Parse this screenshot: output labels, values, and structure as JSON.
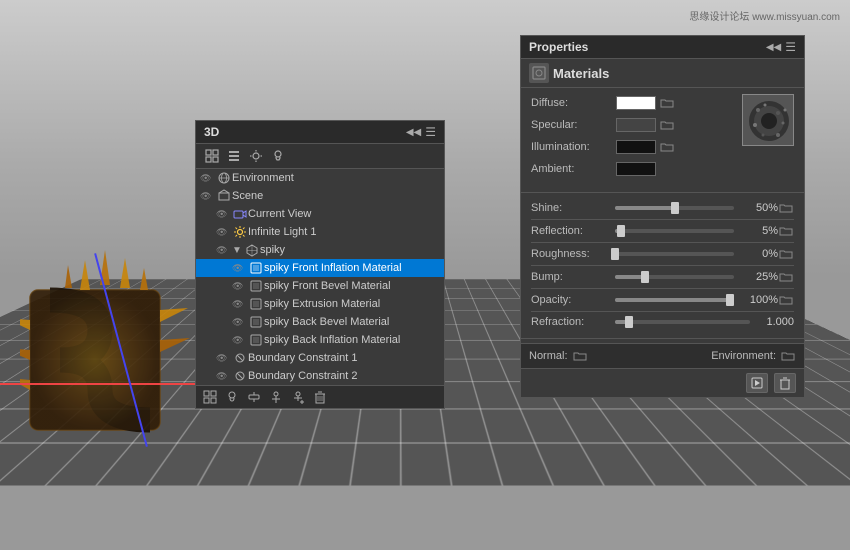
{
  "watermark": "思缘设计论坛 www.missyuan.com",
  "panel3d": {
    "title": "3D",
    "toolbar_icons": [
      "grid",
      "list",
      "light",
      "bulb"
    ],
    "items": [
      {
        "id": "environment",
        "label": "Environment",
        "indent": 0,
        "icon": "env",
        "eye": true
      },
      {
        "id": "scene",
        "label": "Scene",
        "indent": 0,
        "icon": "scene",
        "eye": true
      },
      {
        "id": "current-view",
        "label": "Current View",
        "indent": 1,
        "icon": "cam",
        "eye": true
      },
      {
        "id": "infinite-light",
        "label": "Infinite Light 1",
        "indent": 1,
        "icon": "sun",
        "eye": true
      },
      {
        "id": "spiky",
        "label": "spiky",
        "indent": 1,
        "icon": "mesh",
        "eye": true
      },
      {
        "id": "spiky-front-inflation",
        "label": "spiky Front Inflation Material",
        "indent": 2,
        "icon": "mat",
        "eye": true,
        "selected": true
      },
      {
        "id": "spiky-front-bevel",
        "label": "spiky Front Bevel Material",
        "indent": 2,
        "icon": "mat",
        "eye": true
      },
      {
        "id": "spiky-extrusion",
        "label": "spiky Extrusion Material",
        "indent": 2,
        "icon": "mat",
        "eye": true
      },
      {
        "id": "spiky-back-bevel",
        "label": "spiky Back Bevel Material",
        "indent": 2,
        "icon": "mat",
        "eye": true
      },
      {
        "id": "spiky-back-inflation",
        "label": "spiky Back Inflation Material",
        "indent": 2,
        "icon": "mat",
        "eye": true
      },
      {
        "id": "boundary-1",
        "label": "Boundary Constraint 1",
        "indent": 1,
        "icon": "constraint",
        "eye": true
      },
      {
        "id": "boundary-2",
        "label": "Boundary Constraint 2",
        "indent": 1,
        "icon": "constraint",
        "eye": true
      }
    ],
    "footer_icons": [
      "grid2",
      "bulb2",
      "move",
      "anchor",
      "addanchor",
      "trash"
    ]
  },
  "propsPanel": {
    "title": "Properties",
    "tab": "Materials",
    "diffuse_label": "Diffuse:",
    "specular_label": "Specular:",
    "illumination_label": "Illumination:",
    "ambient_label": "Ambient:",
    "shine_label": "Shine:",
    "shine_value": "50%",
    "shine_percent": 50,
    "reflection_label": "Reflection:",
    "reflection_value": "5%",
    "reflection_percent": 5,
    "roughness_label": "Roughness:",
    "roughness_value": "0%",
    "roughness_percent": 0,
    "bump_label": "Bump:",
    "bump_value": "25%",
    "bump_percent": 25,
    "opacity_label": "Opacity:",
    "opacity_value": "100%",
    "opacity_percent": 100,
    "refraction_label": "Refraction:",
    "refraction_value": "1.000",
    "refraction_percent": 10,
    "normal_label": "Normal:",
    "environment_label": "Environment:",
    "footer_actions": [
      "render",
      "trash"
    ]
  }
}
